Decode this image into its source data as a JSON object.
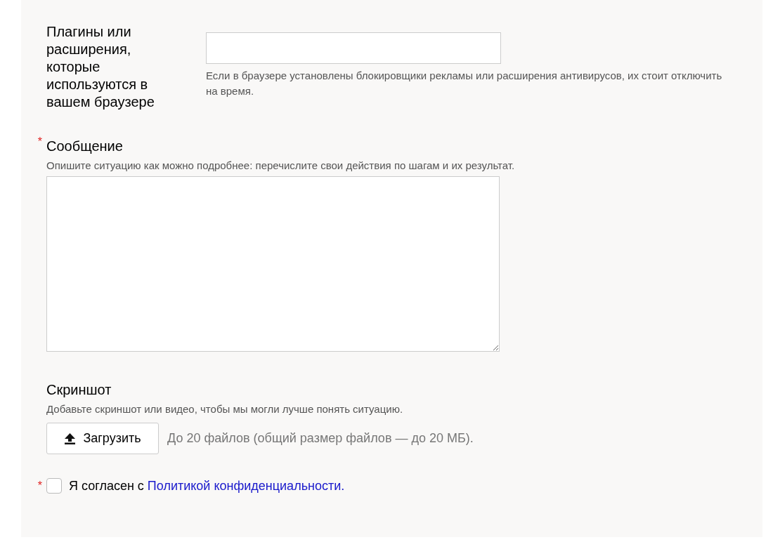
{
  "plugins_field": {
    "label": "Плагины или расширения, которые используются в вашем браузере",
    "hint": "Если в браузере установлены блокировщики рекламы или расширения антивирусов, их стоит отключить на время.",
    "required": false
  },
  "message_field": {
    "label": "Сообщение",
    "required": true,
    "required_mark": "*",
    "description": "Опишите ситуацию как можно подробнее: перечислите свои действия по шагам и их результат."
  },
  "screenshot_field": {
    "label": "Скриншот",
    "required": false,
    "description": "Добавьте скриншот или видео, чтобы мы могли лучше понять ситуацию.",
    "upload_button": "Загрузить",
    "note": "До 20 файлов (общий размер файлов — до 20 МБ)."
  },
  "consent": {
    "required": true,
    "required_mark": "*",
    "checked": false,
    "text": "Я согласен с",
    "link": "Политикой конфиденциальности."
  }
}
